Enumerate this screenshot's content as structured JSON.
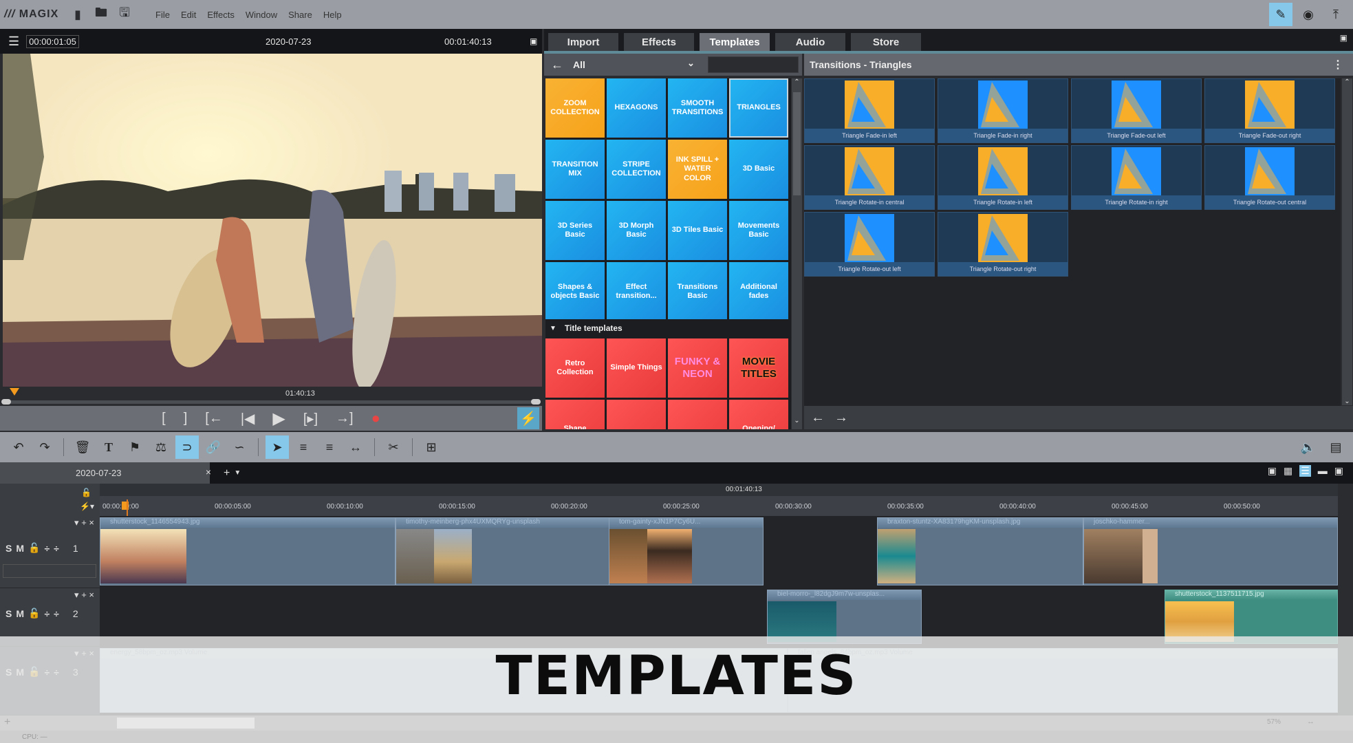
{
  "app": {
    "logo": "MAGIX",
    "menu": [
      "File",
      "Edit",
      "Effects",
      "Window",
      "Share",
      "Help"
    ]
  },
  "menubar_icons": [
    "new-file-icon",
    "open-folder-icon",
    "save-icon"
  ],
  "menubar_right": [
    "clean-up-icon",
    "disc-icon",
    "export-icon"
  ],
  "preview": {
    "timecode": "00:00:01:05",
    "project_name": "2020-07-23",
    "duration": "00:01:40:13",
    "scrub_label": "01:40:13",
    "playhead_position": 0.01
  },
  "transport": [
    "mark-in",
    "mark-out",
    "jump-to-in",
    "prev-marker",
    "play",
    "next-marker",
    "jump-to-out",
    "record"
  ],
  "panel": {
    "tabs": [
      {
        "label": "Import"
      },
      {
        "label": "Effects"
      },
      {
        "label": "Templates",
        "active": true
      },
      {
        "label": "Audio"
      },
      {
        "label": "Store"
      }
    ],
    "category_dropdown": "All",
    "search_value": "",
    "content_title": "Transitions - Triangles"
  },
  "transition_categories": [
    {
      "label": "ZOOM COLLECTION",
      "color": "#f9b233"
    },
    {
      "label": "HEXAGONS"
    },
    {
      "label": "SMOOTH TRANSITIONS"
    },
    {
      "label": "TRIANGLES",
      "selected": true
    },
    {
      "label": "TRANSITION MIX"
    },
    {
      "label": "STRIPE COLLECTION"
    },
    {
      "label": "INK SPILL + WATER COLOR",
      "color": "#f9b233"
    },
    {
      "label": "3D Basic"
    },
    {
      "label": "3D Series Basic"
    },
    {
      "label": "3D Morph Basic"
    },
    {
      "label": "3D Tiles Basic"
    },
    {
      "label": "Movements Basic"
    },
    {
      "label": "Shapes & objects Basic"
    },
    {
      "label": "Effect transition..."
    },
    {
      "label": "Transitions Basic"
    },
    {
      "label": "Additional fades"
    }
  ],
  "title_section": {
    "label": "Title templates"
  },
  "title_templates": [
    {
      "label": "Retro Collection"
    },
    {
      "label": "Simple Things"
    },
    {
      "label": "FUNKY & NEON"
    },
    {
      "label": "MOVIE TITLES"
    },
    {
      "label": "Shape"
    },
    {
      "label": ""
    },
    {
      "label": ""
    },
    {
      "label": "Opening/"
    }
  ],
  "triangle_transitions": [
    "Triangle Fade-in left",
    "Triangle Fade-in right",
    "Triangle Fade-out left",
    "Triangle Fade-out right",
    "Triangle Rotate-in central",
    "Triangle Rotate-in left",
    "Triangle Rotate-in right",
    "Triangle Rotate-out central",
    "Triangle Rotate-out left",
    "Triangle Rotate-out right"
  ],
  "timeline": {
    "project_tab": "2020-07-23",
    "ruler_marker": "00:01:40:13",
    "ruler_ticks": [
      "00:00:00:00",
      "00:00:05:00",
      "00:00:10:00",
      "00:00:15:00",
      "00:00:20:00",
      "00:00:25:00",
      "00:00:30:00",
      "00:00:35:00",
      "00:00:40:00",
      "00:00:45:00",
      "00:00:50:00"
    ],
    "tracks": [
      {
        "number": "1",
        "clips": [
          "shutterstock_1146554943.jpg",
          "timothy-meinberg-phx4UXMQRYg-unsplash",
          "tom-gainty-xJN1P7Cy6U...",
          "braxton-stuntz-XA83179hgKM-unsplash.jpg",
          "joschko-hammer..."
        ]
      },
      {
        "number": "2",
        "clips": [
          "biel-morro-_l82dgJ9m7w-unsplas...",
          "shutterstock_1137511715.jpg"
        ]
      },
      {
        "number": "3",
        "clips": [
          "energy_58bpm_oz.mp3  Volume",
          "fallen angels_84bpm_oz.mp3  Volume"
        ]
      }
    ],
    "track_controls": {
      "solo": "S",
      "mute": "M"
    },
    "zoom_level": "57%"
  },
  "status": {
    "cpu": "CPU: —"
  },
  "banner": {
    "text": "TEMPLATES"
  }
}
